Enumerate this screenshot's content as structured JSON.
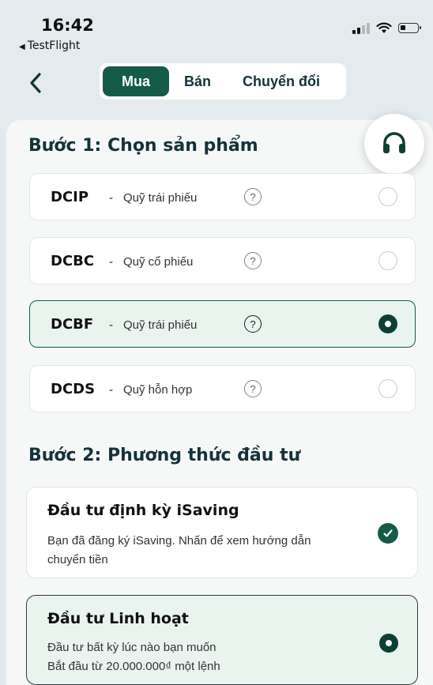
{
  "status": {
    "time": "16:42",
    "back_app": "TestFlight"
  },
  "tabs": [
    {
      "label": "Mua",
      "active": true
    },
    {
      "label": "Bán",
      "active": false
    },
    {
      "label": "Chuyển đổi",
      "active": false
    }
  ],
  "step1": {
    "title": "Bước 1: Chọn sản phẩm",
    "funds": [
      {
        "code": "DCIP",
        "desc": "Quỹ trái phiếu",
        "selected": false
      },
      {
        "code": "DCBC",
        "desc": "Quỹ cổ phiếu",
        "selected": false
      },
      {
        "code": "DCBF",
        "desc": "Quỹ trái phiếu",
        "selected": true
      },
      {
        "code": "DCDS",
        "desc": "Quỹ hỗn hợp",
        "selected": false
      }
    ]
  },
  "step2": {
    "title": "Bước 2: Phương thức đầu tư",
    "methods": [
      {
        "title": "Đầu tư định kỳ iSaving",
        "line1": "Bạn đã đăng ký iSaving. Nhấn để xem hướng dẫn",
        "line2": "chuyển tiền"
      },
      {
        "title": "Đầu tư Linh hoạt",
        "line1": "Đầu tư bất kỳ lúc nào bạn muốn",
        "line2": "Bắt đầu từ 20.000.000₫ một lệnh"
      }
    ]
  },
  "colors": {
    "brand": "#145c48",
    "radio_selected": "#0f3f36",
    "header_bg": "#e3ebee",
    "selected_card_bg": "#e9f4ef"
  },
  "icons": [
    "back-chevron-icon",
    "headset-icon",
    "help-icon",
    "check-icon"
  ]
}
